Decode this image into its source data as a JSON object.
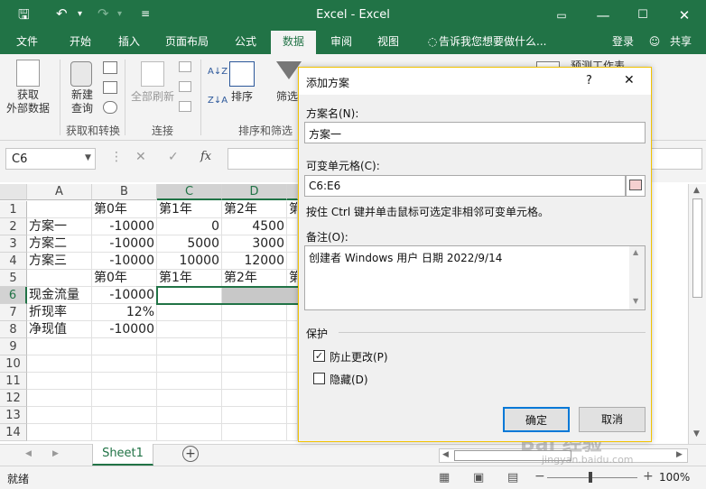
{
  "app": {
    "title": "Excel - Excel"
  },
  "quick_access": {
    "save_icon": "save-icon",
    "undo_icon": "undo-icon",
    "redo_icon": "redo-icon",
    "customize_icon": "customize-icon"
  },
  "tabs": [
    {
      "label": "文件"
    },
    {
      "label": "开始"
    },
    {
      "label": "插入"
    },
    {
      "label": "页面布局"
    },
    {
      "label": "公式"
    },
    {
      "label": "数据"
    },
    {
      "label": "审阅"
    },
    {
      "label": "视图"
    }
  ],
  "tell_me": "告诉我您想要做什么...",
  "login": "登录",
  "share": "共享",
  "ribbon": {
    "get_external": "获取\n外部数据",
    "new_query": "新建\n查询",
    "refresh_all": "全部刷新",
    "sort": "排序",
    "filter": "筛选",
    "group_get_transform": "获取和转换",
    "group_connections": "连接",
    "group_sort_filter": "排序和筛选",
    "forecast": "预测工作表"
  },
  "formula_bar": {
    "name_box": "C6",
    "fx": "fx"
  },
  "columns": [
    "A",
    "B",
    "C",
    "D"
  ],
  "rows": [
    {
      "n": "1",
      "A": "",
      "B": "第0年",
      "C": "第1年",
      "D": "第2年",
      "E": "第"
    },
    {
      "n": "2",
      "A": "方案一",
      "B": "-10000",
      "C": "0",
      "D": "4500",
      "E": ""
    },
    {
      "n": "3",
      "A": "方案二",
      "B": "-10000",
      "C": "5000",
      "D": "3000",
      "E": ""
    },
    {
      "n": "4",
      "A": "方案三",
      "B": "-10000",
      "C": "10000",
      "D": "12000",
      "E": ""
    },
    {
      "n": "5",
      "A": "",
      "B": "第0年",
      "C": "第1年",
      "D": "第2年",
      "E": "第"
    },
    {
      "n": "6",
      "A": "现金流量",
      "B": "-10000",
      "C": "",
      "D": "",
      "E": ""
    },
    {
      "n": "7",
      "A": "折现率",
      "B": "12%",
      "C": "",
      "D": "",
      "E": ""
    },
    {
      "n": "8",
      "A": "净现值",
      "B": "-10000",
      "C": "",
      "D": "",
      "E": ""
    },
    {
      "n": "9",
      "A": "",
      "B": "",
      "C": "",
      "D": "",
      "E": ""
    },
    {
      "n": "10",
      "A": "",
      "B": "",
      "C": "",
      "D": "",
      "E": ""
    },
    {
      "n": "11",
      "A": "",
      "B": "",
      "C": "",
      "D": "",
      "E": ""
    },
    {
      "n": "12",
      "A": "",
      "B": "",
      "C": "",
      "D": "",
      "E": ""
    },
    {
      "n": "13",
      "A": "",
      "B": "",
      "C": "",
      "D": "",
      "E": ""
    },
    {
      "n": "14",
      "A": "",
      "B": "",
      "C": "",
      "D": "",
      "E": ""
    }
  ],
  "sheet_tab": "Sheet1",
  "status": {
    "ready": "就绪",
    "zoom": "100%"
  },
  "dialog": {
    "title": "添加方案",
    "help": "?",
    "close": "✕",
    "name_label": "方案名(N):",
    "name_value": "方案一",
    "cells_label": "可变单元格(C):",
    "cells_value": "C6:E6",
    "hint": "按住 Ctrl 键并单击鼠标可选定非相邻可变单元格。",
    "comment_label": "备注(O):",
    "comment_value": "创建者 Windows 用户 日期 2022/9/14",
    "protect_label": "保护",
    "prevent_changes": "防止更改(P)",
    "prevent_checked": true,
    "hide": "隐藏(D)",
    "hide_checked": false,
    "ok": "确定",
    "cancel": "取消"
  },
  "watermark": "Bai 经验",
  "watermark_url": "jingyan.baidu.com"
}
